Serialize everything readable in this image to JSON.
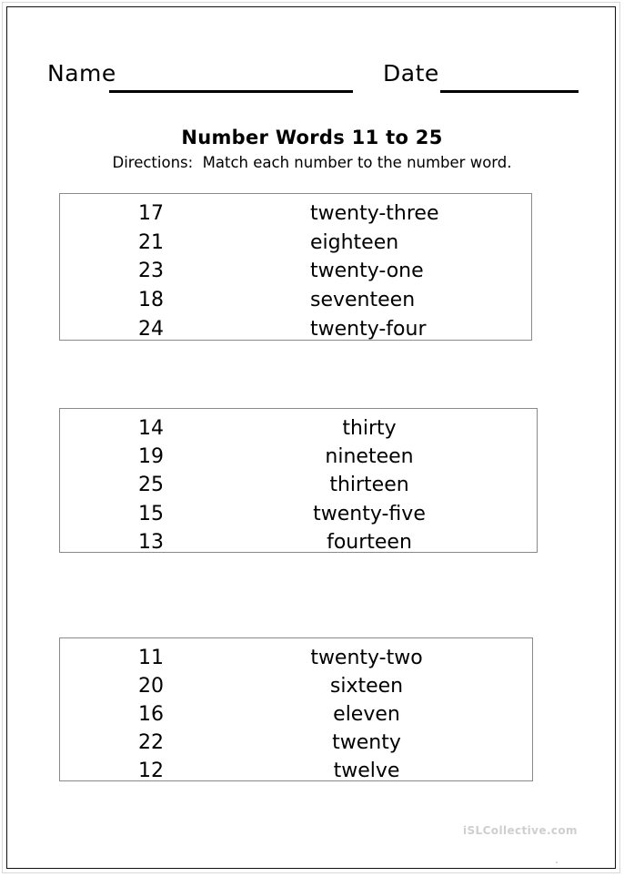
{
  "worksheet": {
    "header": {
      "name_label": "Name",
      "date_label": "Date"
    },
    "title": "Number Words 11 to 25",
    "directions": "Directions:  Match each number to the number word.",
    "watermark": "iSLCollective.com",
    "boxes": [
      {
        "rows": [
          {
            "number": "17",
            "word": "twenty-three"
          },
          {
            "number": "21",
            "word": "eighteen"
          },
          {
            "number": "23",
            "word": "twenty-one"
          },
          {
            "number": "18",
            "word": "seventeen"
          },
          {
            "number": "24",
            "word": "twenty-four"
          }
        ]
      },
      {
        "rows": [
          {
            "number": "14",
            "word": "thirty"
          },
          {
            "number": "19",
            "word": "nineteen"
          },
          {
            "number": "25",
            "word": "thirteen"
          },
          {
            "number": "15",
            "word": "twenty-five"
          },
          {
            "number": "13",
            "word": "fourteen"
          }
        ]
      },
      {
        "rows": [
          {
            "number": "11",
            "word": "twenty-two"
          },
          {
            "number": "20",
            "word": "sixteen"
          },
          {
            "number": "16",
            "word": "eleven"
          },
          {
            "number": "22",
            "word": "twenty"
          },
          {
            "number": "12",
            "word": "twelve"
          }
        ]
      }
    ]
  }
}
